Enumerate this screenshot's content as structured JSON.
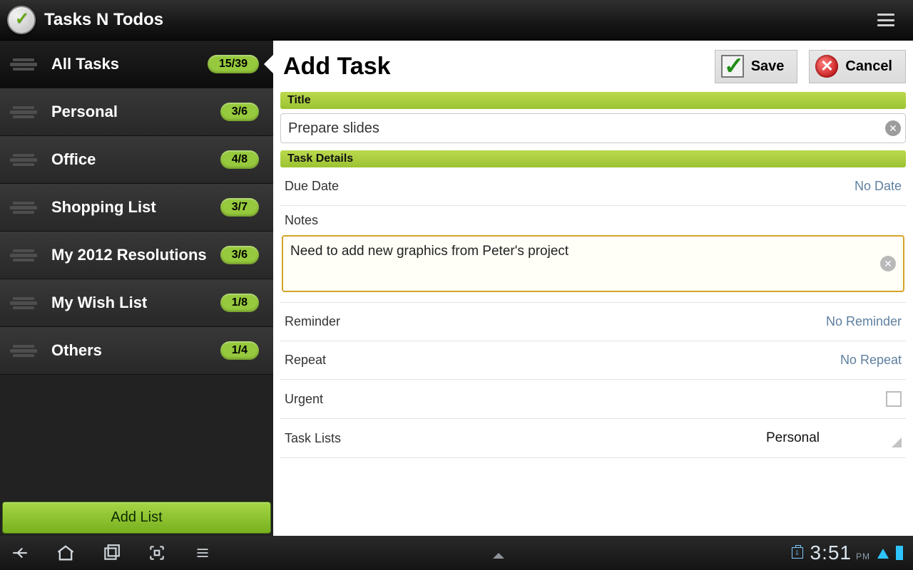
{
  "app": {
    "title": "Tasks N Todos"
  },
  "sidebar": {
    "items": [
      {
        "label": "All Tasks",
        "count": "15/39",
        "active": true
      },
      {
        "label": "Personal",
        "count": "3/6"
      },
      {
        "label": "Office",
        "count": "4/8"
      },
      {
        "label": "Shopping List",
        "count": "3/7"
      },
      {
        "label": "My 2012 Resolutions",
        "count": "3/6"
      },
      {
        "label": "My Wish List",
        "count": "1/8"
      },
      {
        "label": "Others",
        "count": "1/4"
      }
    ],
    "add_list_label": "Add List"
  },
  "panel": {
    "title": "Add Task",
    "save_label": "Save",
    "cancel_label": "Cancel",
    "section_title": "Title",
    "title_value": "Prepare slides",
    "section_details": "Task Details",
    "due_date_label": "Due Date",
    "due_date_value": "No Date",
    "notes_label": "Notes",
    "notes_value": "Need to add new graphics from Peter's project",
    "reminder_label": "Reminder",
    "reminder_value": "No Reminder",
    "repeat_label": "Repeat",
    "repeat_value": "No Repeat",
    "urgent_label": "Urgent",
    "tasklists_label": "Task Lists",
    "tasklists_value": "Personal"
  },
  "statusbar": {
    "time": "3:51",
    "ampm": "PM"
  }
}
